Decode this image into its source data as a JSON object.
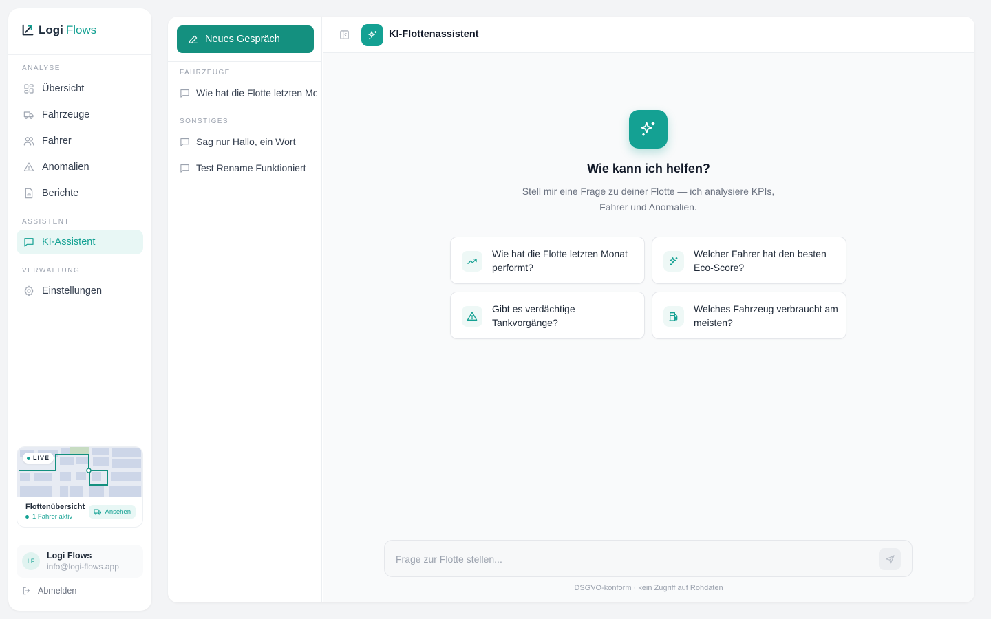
{
  "brand": {
    "name_part1": "Logi",
    "name_part2": "Flows",
    "accent": "#14a193"
  },
  "sidebar": {
    "sections": {
      "analyse": "ANALYSE",
      "assistent": "ASSISTENT",
      "verwaltung": "VERWALTUNG"
    },
    "items": [
      {
        "label": "Übersicht",
        "icon": "grid-icon"
      },
      {
        "label": "Fahrzeuge",
        "icon": "truck-icon"
      },
      {
        "label": "Fahrer",
        "icon": "users-icon"
      },
      {
        "label": "Anomalien",
        "icon": "warning-icon"
      },
      {
        "label": "Berichte",
        "icon": "report-icon"
      },
      {
        "label": "KI-Assistent",
        "icon": "chat-icon",
        "active": true
      },
      {
        "label": "Einstellungen",
        "icon": "gear-icon"
      }
    ],
    "map_card": {
      "live": "LIVE",
      "title": "Flottenübersicht",
      "subtitle": "1 Fahrer aktiv",
      "button": "Ansehen"
    },
    "user": {
      "initials": "LF",
      "name": "Logi Flows",
      "email": "info@logi-flows.app"
    },
    "logout": "Abmelden"
  },
  "conversations": {
    "new_button": "Neues Gespräch",
    "groups": [
      {
        "title": "FAHRZEUGE",
        "items": [
          "Wie hat die Flotte letzten Monat performt?"
        ]
      },
      {
        "title": "SONSTIGES",
        "items": [
          "Sag nur Hallo, ein Wort",
          "Test Rename Funktioniert"
        ]
      }
    ]
  },
  "chat": {
    "title": "KI-Flottenassistent",
    "hero_title": "Wie kann ich helfen?",
    "hero_subtitle": "Stell mir eine Frage zu deiner Flotte — ich analysiere KPIs, Fahrer und Anomalien.",
    "suggestions": [
      {
        "text": "Wie hat die Flotte letzten Monat performt?",
        "icon": "trending-up-icon"
      },
      {
        "text": "Welcher Fahrer hat den besten Eco-Score?",
        "icon": "sparkles-icon"
      },
      {
        "text": "Gibt es verdächtige Tankvorgänge?",
        "icon": "warning-icon"
      },
      {
        "text": "Welches Fahrzeug verbraucht am meisten?",
        "icon": "fuel-icon"
      }
    ],
    "input_placeholder": "Frage zur Flotte stellen...",
    "footnote": "DSGVO-konform · kein Zugriff auf Rohdaten"
  }
}
